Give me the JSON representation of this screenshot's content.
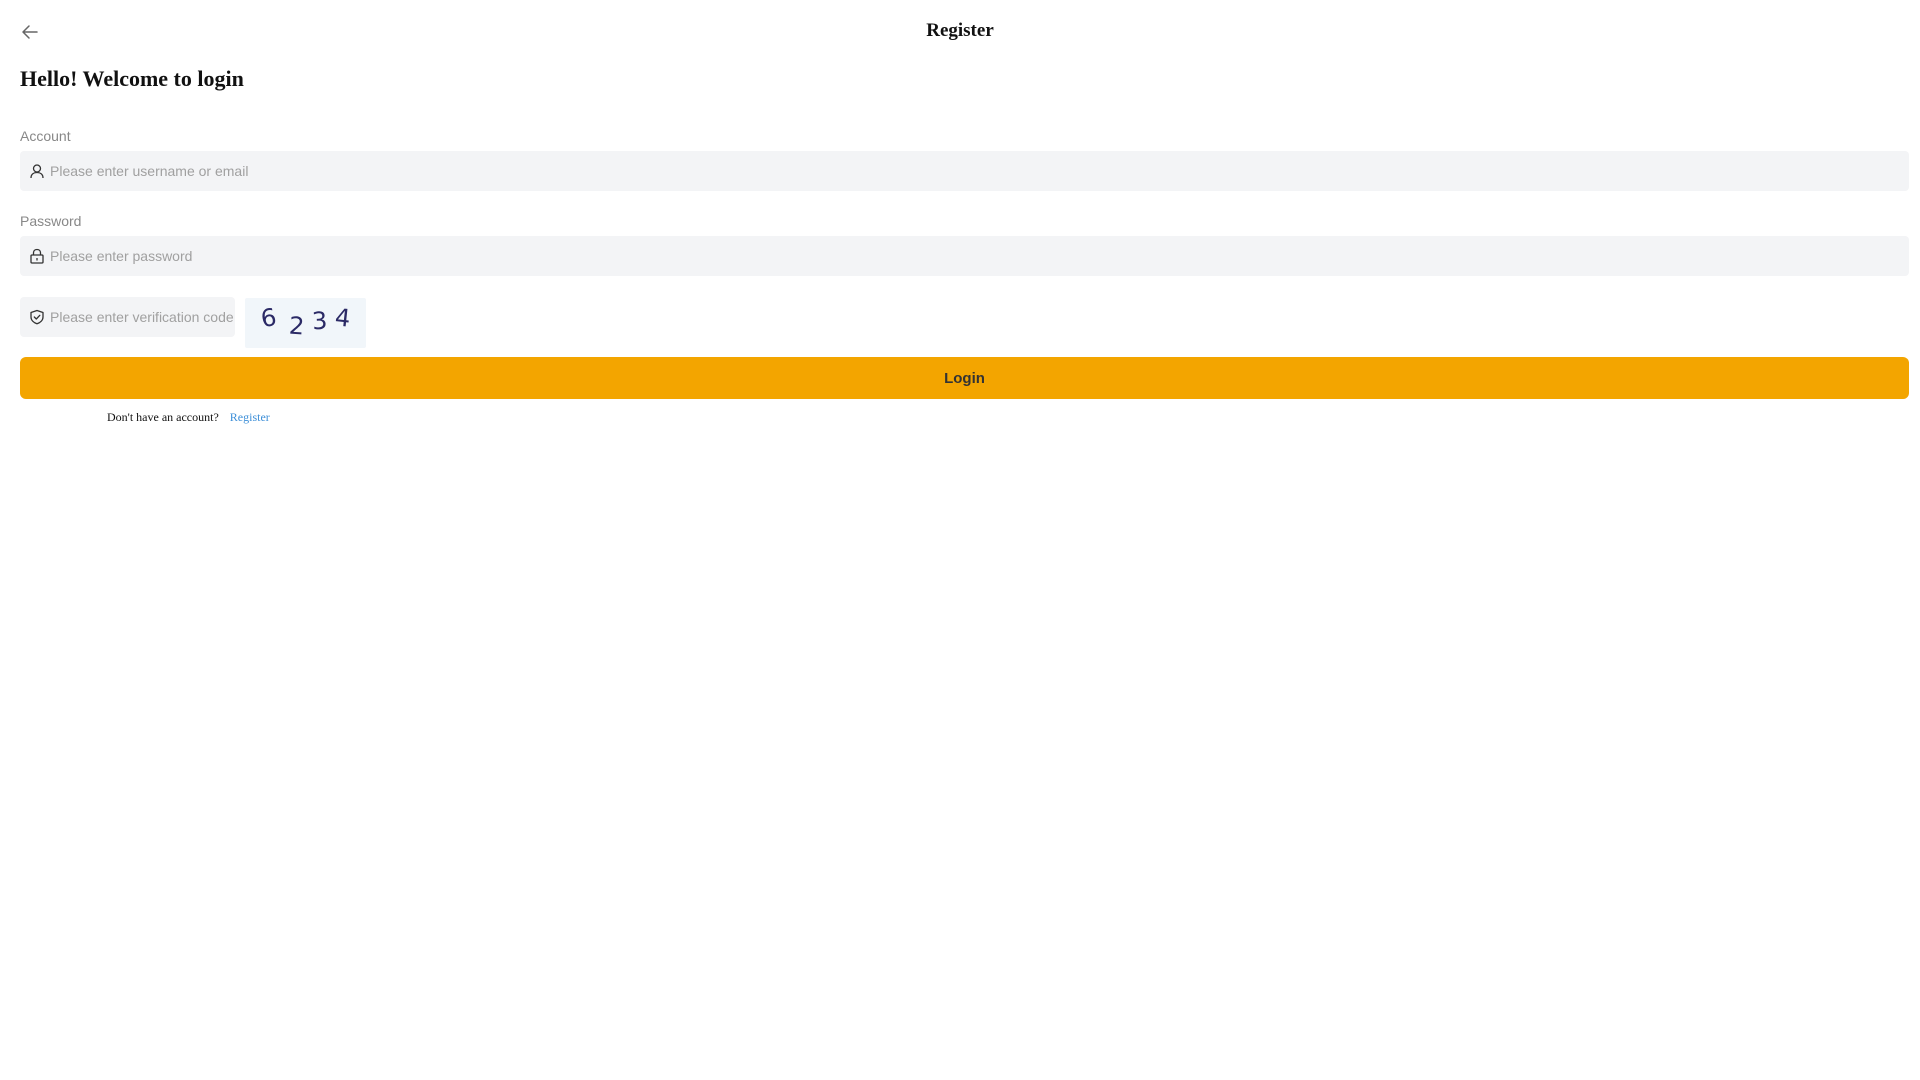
{
  "header": {
    "back_icon": "arrow-left-icon",
    "title": "Register"
  },
  "welcome": "Hello! Welcome to login",
  "form": {
    "account": {
      "label": "Account",
      "icon": "user-icon",
      "placeholder": "Please enter username or email",
      "value": ""
    },
    "password": {
      "label": "Password",
      "icon": "lock-icon",
      "placeholder": "Please enter password",
      "value": ""
    },
    "verification": {
      "icon": "shield-check-icon",
      "placeholder": "Please enter verification code",
      "value": "",
      "captcha_chars": [
        "6",
        "2",
        "3",
        "4"
      ]
    },
    "login_label": "Login"
  },
  "footer": {
    "prompt": "Don't have an account?",
    "register_link": "Register"
  },
  "colors": {
    "accent": "#f3a500",
    "link": "#3d8fd8",
    "input_bg": "#f3f4f6",
    "captcha_text": "#2b2a66"
  }
}
